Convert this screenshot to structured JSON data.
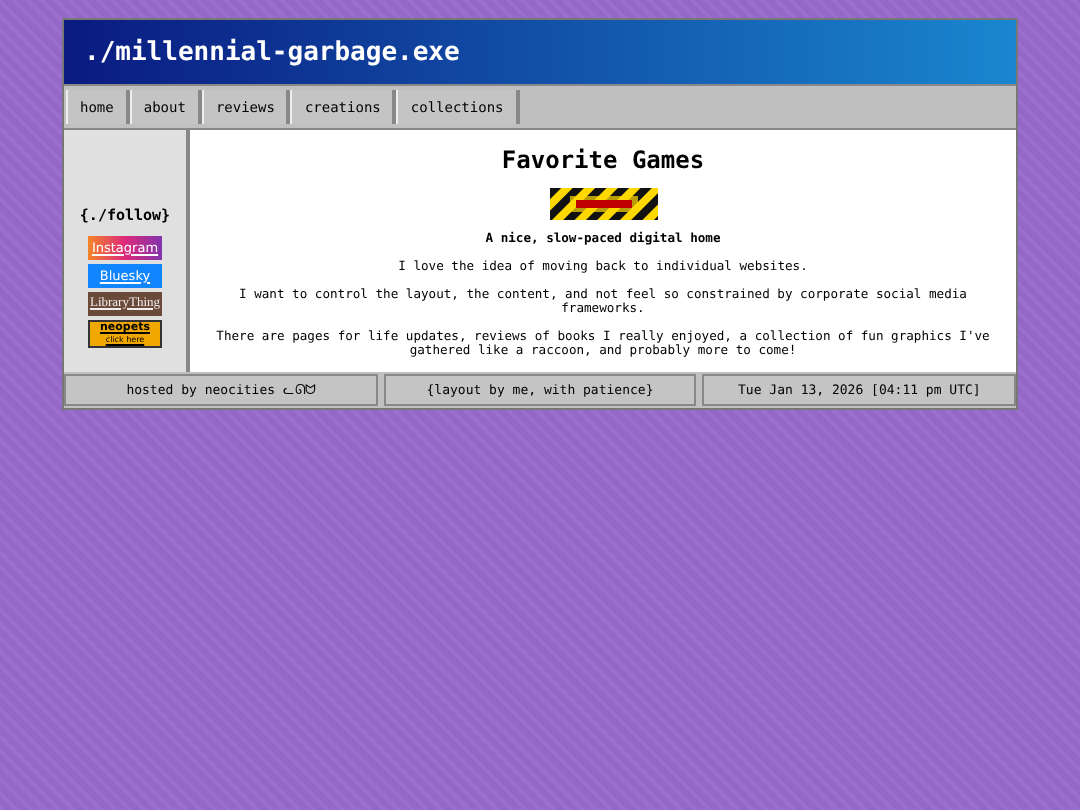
{
  "window": {
    "title": "./millennial-garbage.exe"
  },
  "nav": [
    {
      "label": "home"
    },
    {
      "label": "about"
    },
    {
      "label": "reviews"
    },
    {
      "label": "creations"
    },
    {
      "label": "collections"
    }
  ],
  "sidebar": {
    "heading": "{./follow}",
    "badges": [
      {
        "kind": "instagram",
        "label": "Instagram"
      },
      {
        "kind": "bluesky",
        "label": "Bluesky"
      },
      {
        "kind": "librarything",
        "label": "LibraryThing"
      },
      {
        "kind": "neopets",
        "label": "neopets",
        "sublabel": "click here"
      }
    ]
  },
  "content": {
    "heading": "Favorite Games",
    "tagline": "A nice, slow-paced digital home",
    "paragraphs": [
      "I love the idea of moving back to individual websites.",
      "I want to control the layout, the content, and not feel so constrained by corporate social media frameworks.",
      "There are pages for life updates, reviews of books I really enjoyed, a collection of fun graphics I've gathered like a raccoon, and probably more to come!"
    ]
  },
  "status_bar": [
    "hosted by neocities ᓚᘏᗢ",
    "{layout by me, with patience}",
    "Tue Jan 13, 2026 [04:11 pm UTC]"
  ]
}
